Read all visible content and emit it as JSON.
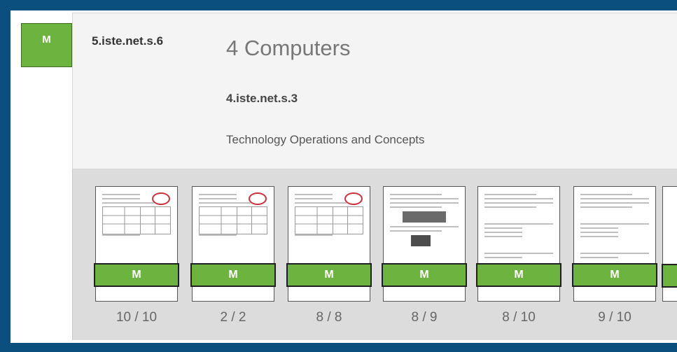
{
  "standard": {
    "mastery_label": "M",
    "parent_code": "5.iste.net.s.6",
    "title": "4 Computers",
    "child_code": "4.iste.net.s.3",
    "description": "Technology Operations and Concepts"
  },
  "work_items": [
    {
      "mastery": "M",
      "score": "10 / 10",
      "thumbnail": "rubric-document"
    },
    {
      "mastery": "M",
      "score": "2 / 2",
      "thumbnail": "rubric-document"
    },
    {
      "mastery": "M",
      "score": "8 / 8",
      "thumbnail": "rubric-document"
    },
    {
      "mastery": "M",
      "score": "8 / 9",
      "thumbnail": "worksheet-with-photos"
    },
    {
      "mastery": "M",
      "score": "8 / 10",
      "thumbnail": "text-worksheet"
    },
    {
      "mastery": "M",
      "score": "9 / 10",
      "thumbnail": "text-worksheet"
    }
  ],
  "colors": {
    "background": "#0a4f7e",
    "mastery_green": "#6db33f",
    "strip_gray": "#dcdcdc"
  }
}
